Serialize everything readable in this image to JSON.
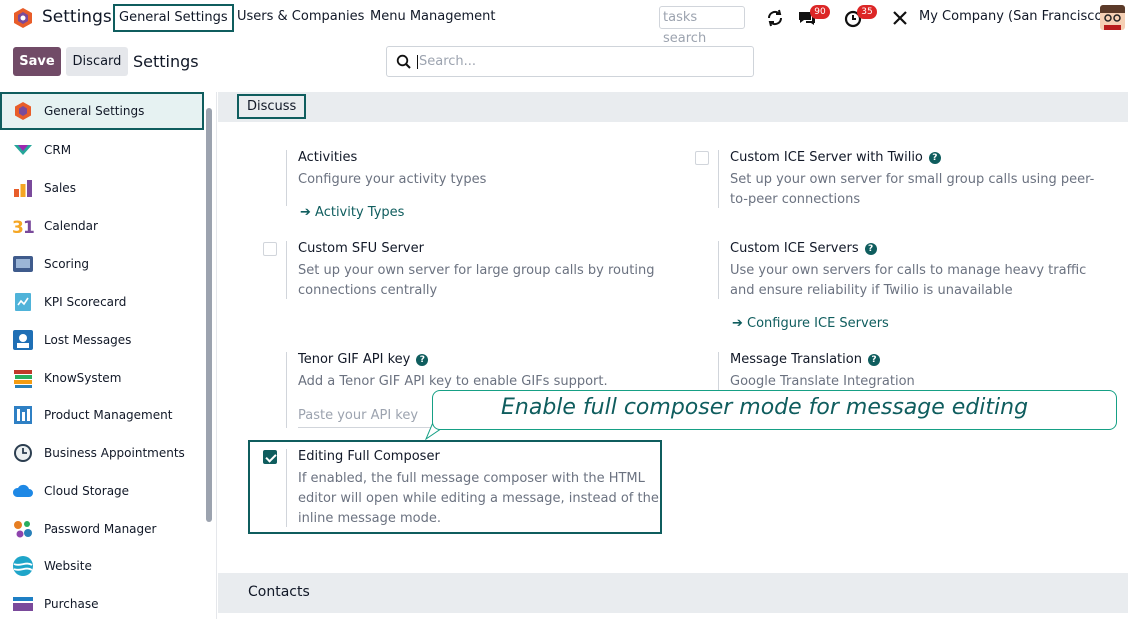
{
  "topbar": {
    "app_name": "Settings",
    "menus": [
      "General Settings",
      "Users & Companies",
      "Menu Management"
    ],
    "tasks_search": "tasks search",
    "chat_badge": "90",
    "activity_badge": "35",
    "company": "My Company (San Francisco)"
  },
  "control": {
    "save_label": "Save",
    "discard_label": "Discard",
    "title": "Settings",
    "search_placeholder": "Search..."
  },
  "sidebar": {
    "items": [
      {
        "label": "General Settings",
        "icon": "general-settings-icon"
      },
      {
        "label": "CRM",
        "icon": "crm-icon"
      },
      {
        "label": "Sales",
        "icon": "sales-icon"
      },
      {
        "label": "Calendar",
        "icon": "calendar-icon"
      },
      {
        "label": "Scoring",
        "icon": "scoring-icon"
      },
      {
        "label": "KPI Scorecard",
        "icon": "kpi-scorecard-icon"
      },
      {
        "label": "Lost Messages",
        "icon": "lost-messages-icon"
      },
      {
        "label": "KnowSystem",
        "icon": "knowsystem-icon"
      },
      {
        "label": "Product Management",
        "icon": "product-management-icon"
      },
      {
        "label": "Business Appointments",
        "icon": "business-appointments-icon"
      },
      {
        "label": "Cloud Storage",
        "icon": "cloud-storage-icon"
      },
      {
        "label": "Password Manager",
        "icon": "password-manager-icon"
      },
      {
        "label": "Website",
        "icon": "website-icon"
      },
      {
        "label": "Purchase",
        "icon": "purchase-icon"
      }
    ]
  },
  "main": {
    "section_discuss": "Discuss",
    "section_contacts": "Contacts",
    "activities": {
      "title": "Activities",
      "desc": "Configure your activity types",
      "link": "Activity Types"
    },
    "ice_twilio": {
      "title": "Custom ICE Server with Twilio",
      "desc": "Set up your own server for small group calls using peer-to-peer connections",
      "checked": false
    },
    "sfu": {
      "title": "Custom SFU Server",
      "desc": "Set up your own server for large group calls by routing connections centrally",
      "checked": false
    },
    "ice_servers": {
      "title": "Custom ICE Servers",
      "desc": "Use your own servers for calls to manage heavy traffic and ensure reliability if Twilio is unavailable",
      "link": "Configure ICE Servers"
    },
    "tenor": {
      "title": "Tenor GIF API key",
      "desc": "Add a Tenor GIF API key to enable GIFs support.",
      "placeholder": "Paste your API key"
    },
    "translation": {
      "title": "Message Translation",
      "desc": "Google Translate Integration"
    },
    "composer": {
      "title": "Editing Full Composer",
      "desc": "If enabled, the full message composer with the HTML editor will open while editing a message, instead of the inline message mode.",
      "checked": true
    }
  },
  "callout": {
    "text": "Enable full composer mode for message editing"
  },
  "colors": {
    "brand": "#714b67",
    "accent": "#0f5d5e",
    "badge": "#dc2626"
  }
}
